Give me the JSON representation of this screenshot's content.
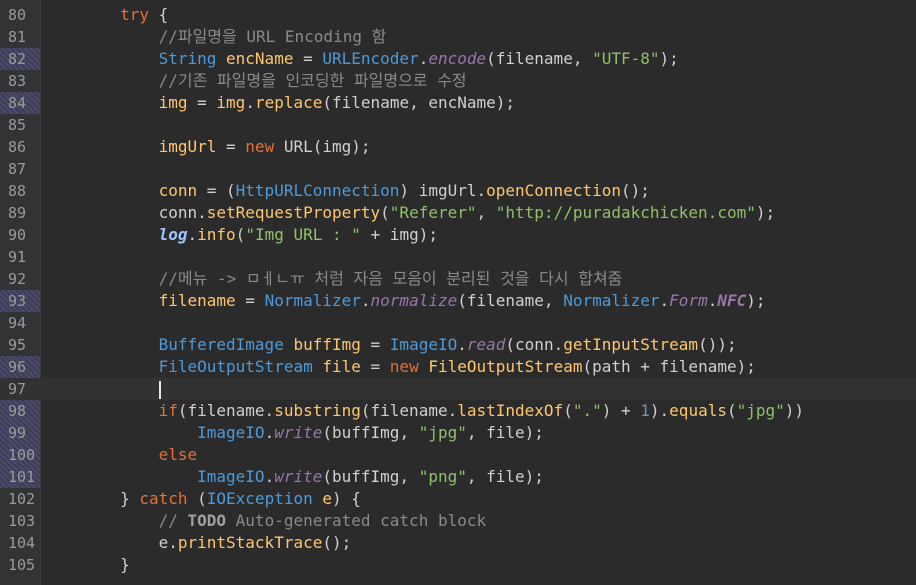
{
  "editor": {
    "lines": [
      {
        "num": "80",
        "changed": false
      },
      {
        "num": "81",
        "changed": false
      },
      {
        "num": "82",
        "changed": true
      },
      {
        "num": "83",
        "changed": false
      },
      {
        "num": "84",
        "changed": true
      },
      {
        "num": "85",
        "changed": false
      },
      {
        "num": "86",
        "changed": false
      },
      {
        "num": "87",
        "changed": false
      },
      {
        "num": "88",
        "changed": false
      },
      {
        "num": "89",
        "changed": false
      },
      {
        "num": "90",
        "changed": false
      },
      {
        "num": "91",
        "changed": false
      },
      {
        "num": "92",
        "changed": false
      },
      {
        "num": "93",
        "changed": true
      },
      {
        "num": "94",
        "changed": false
      },
      {
        "num": "95",
        "changed": false
      },
      {
        "num": "96",
        "changed": true
      },
      {
        "num": "97",
        "changed": false
      },
      {
        "num": "98",
        "changed": true
      },
      {
        "num": "99",
        "changed": true
      },
      {
        "num": "100",
        "changed": true
      },
      {
        "num": "101",
        "changed": true
      },
      {
        "num": "102",
        "changed": false
      },
      {
        "num": "103",
        "changed": false
      },
      {
        "num": "104",
        "changed": false
      },
      {
        "num": "105",
        "changed": false
      }
    ],
    "code": {
      "l80": {
        "indent": "        ",
        "kw": "try",
        "rest": " {"
      },
      "l81": {
        "indent": "            ",
        "comment": "//파일명을 URL Encoding 함"
      },
      "l82": {
        "indent": "            ",
        "type": "String",
        "var": " encName",
        "eq": " = ",
        "cls": "URLEncoder",
        "dot": ".",
        "static_call": "encode",
        "args_open": "(filename, ",
        "str": "\"UTF-8\"",
        "end": ");"
      },
      "l83": {
        "indent": "            ",
        "comment": "//기존 파일명을 인코딩한 파일명으로 수정"
      },
      "l84": {
        "indent": "            ",
        "a": "img",
        "eq": " = ",
        "b": "img",
        "dot": ".",
        "method": "replace",
        "end": "(filename, encName);"
      },
      "l85": {
        "text": ""
      },
      "l86": {
        "indent": "            ",
        "a": "imgUrl",
        "eq": " = ",
        "kw": "new",
        "cls": " URL",
        "end": "(img);"
      },
      "l87": {
        "text": ""
      },
      "l88": {
        "indent": "            ",
        "a": "conn",
        "eq": " = (",
        "type": "HttpURLConnection",
        "mid": ") imgUrl.",
        "method": "openConnection",
        "end": "();"
      },
      "l89": {
        "indent": "            ",
        "a": "conn.",
        "method": "setRequestProperty",
        "open": "(",
        "str1": "\"Referer\"",
        "comma": ", ",
        "str2": "\"http://puradakchicken.com\"",
        "end": ");"
      },
      "l90": {
        "indent": "            ",
        "logv": "log",
        "dot": ".",
        "method": "info",
        "open": "(",
        "str": "\"Img URL : \"",
        "end": " + img);"
      },
      "l91": {
        "text": ""
      },
      "l92": {
        "indent": "            ",
        "comment": "//메뉴 -> ㅁㅔㄴㅠ 처럼 자음 모음이 분리된 것을 다시 합쳐줌"
      },
      "l93": {
        "indent": "            ",
        "a": "filename",
        "eq": " = ",
        "type": "Normalizer",
        "dot": ".",
        "static_call": "normalize",
        "mid": "(filename, ",
        "type2": "Normalizer",
        "dot2": ".",
        "cls2": "Form",
        "dot3": ".",
        "field": "NFC",
        "end": ");"
      },
      "l94": {
        "text": ""
      },
      "l95": {
        "indent": "            ",
        "type": "BufferedImage",
        "var": " buffImg",
        "eq": " = ",
        "type2": "ImageIO",
        "dot": ".",
        "static_call": "read",
        "mid": "(conn.",
        "method": "getInputStream",
        "end": "());"
      },
      "l96": {
        "indent": "            ",
        "type": "FileOutputStream",
        "var": " file",
        "eq": " = ",
        "kw": "new",
        "cls": " FileOutputStream",
        "end": "(path + filename);"
      },
      "l97": {
        "indent": "            "
      },
      "l98": {
        "indent": "            ",
        "kw": "if",
        "open": "(filename.",
        "method": "substring",
        "mid": "(filename.",
        "method2": "lastIndexOf",
        "open2": "(",
        "str": "\".\"",
        "mid2": ") + ",
        "num": "1",
        "mid3": ").",
        "method3": "equals",
        "open3": "(",
        "str2": "\"jpg\"",
        "end": "))"
      },
      "l99": {
        "indent": "                ",
        "type": "ImageIO",
        "dot": ".",
        "static_call": "write",
        "mid": "(buffImg, ",
        "str": "\"jpg\"",
        "end": ", file);"
      },
      "l100": {
        "indent": "            ",
        "kw": "else"
      },
      "l101": {
        "indent": "                ",
        "type": "ImageIO",
        "dot": ".",
        "static_call": "write",
        "mid": "(buffImg, ",
        "str": "\"png\"",
        "end": ", file);"
      },
      "l102": {
        "indent": "        ",
        "close": "} ",
        "kw": "catch",
        "open": " (",
        "type": "IOException",
        "var": " e",
        "end": ") {"
      },
      "l103": {
        "indent": "            ",
        "c1": "// ",
        "todo": "TODO",
        "c2": " Auto-generated catch block"
      },
      "l104": {
        "indent": "            ",
        "text": "e.",
        "method": "printStackTrace",
        "end": "();"
      },
      "l105": {
        "indent": "        ",
        "text": "}"
      }
    }
  }
}
